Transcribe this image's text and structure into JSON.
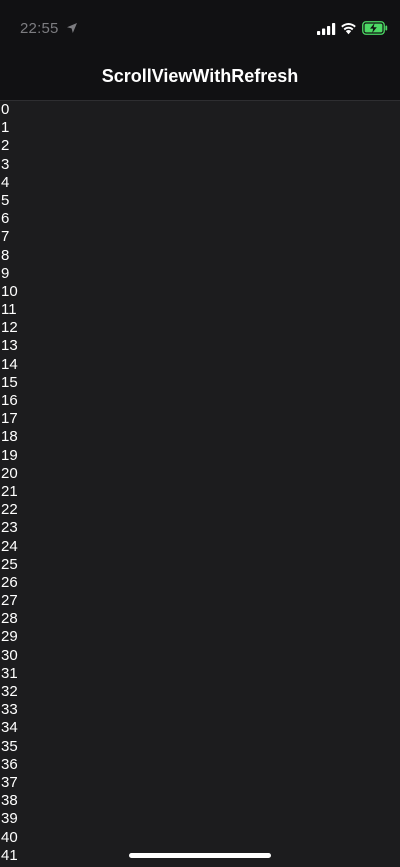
{
  "status_bar": {
    "time": "22:55",
    "icons": [
      "location-arrow-icon",
      "cellular-signal-icon",
      "wifi-icon",
      "battery-charging-icon"
    ],
    "battery_color": "#4cd964"
  },
  "nav_bar": {
    "title": "ScrollViewWithRefresh"
  },
  "list": {
    "items": [
      "0",
      "1",
      "2",
      "3",
      "4",
      "5",
      "6",
      "7",
      "8",
      "9",
      "10",
      "11",
      "12",
      "13",
      "14",
      "15",
      "16",
      "17",
      "18",
      "19",
      "20",
      "21",
      "22",
      "23",
      "24",
      "25",
      "26",
      "27",
      "28",
      "29",
      "30",
      "31",
      "32",
      "33",
      "34",
      "35",
      "36",
      "37",
      "38",
      "39",
      "40",
      "41"
    ]
  },
  "colors": {
    "background": "#1c1c1e",
    "bars": "#111113",
    "text": "#ffffff"
  }
}
